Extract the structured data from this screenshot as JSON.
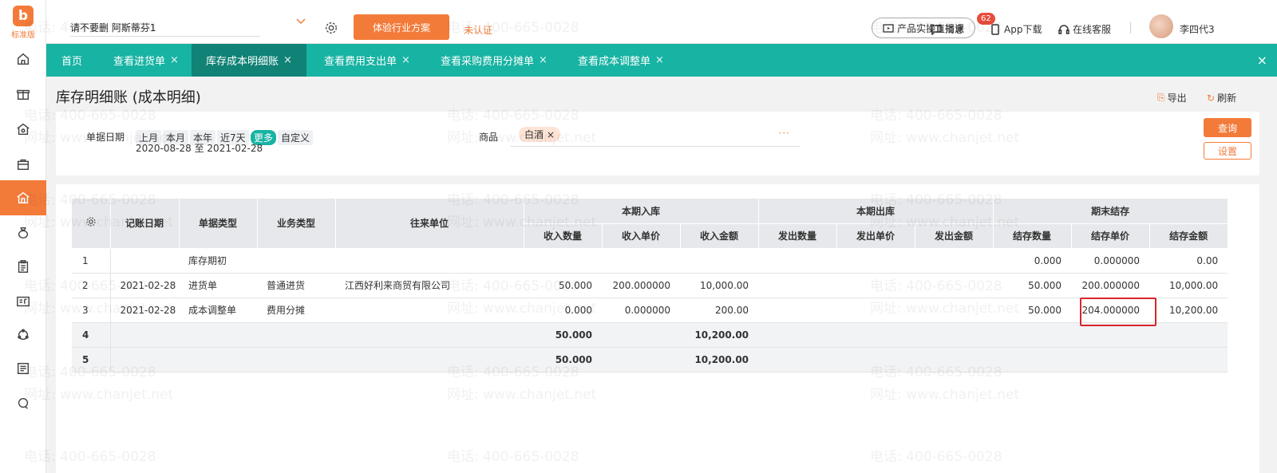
{
  "app": {
    "logo_letter": "b",
    "logo_text": "标准版"
  },
  "topbar": {
    "account_name": "请不要删 阿斯蒂芬1",
    "trial_button": "体验行业方案",
    "unverified": "未认证",
    "live_button": "产品实操直播课",
    "messages": "消息",
    "message_count": "62",
    "app_download": "App下载",
    "online_service": "在线客服",
    "user_name": "李四代3"
  },
  "tabs": [
    {
      "label": "首页",
      "closable": false
    },
    {
      "label": "查看进货单",
      "closable": true
    },
    {
      "label": "库存成本明细账",
      "closable": true,
      "active": true
    },
    {
      "label": "查看费用支出单",
      "closable": true
    },
    {
      "label": "查看采购费用分摊单",
      "closable": true
    },
    {
      "label": "查看成本调整单",
      "closable": true
    }
  ],
  "tab_close_all": "×",
  "page": {
    "title": "库存明细账 (成本明细)",
    "export": "导出",
    "refresh": "刷新"
  },
  "filter": {
    "date_label": "单据日期",
    "chips": [
      "上月",
      "本月",
      "本年",
      "近7天",
      "更多",
      "自定义"
    ],
    "active_chip": "更多",
    "date_from": "2020-08-28",
    "date_to_word": "至",
    "date_to": "2021-02-28",
    "goods_label": "商品",
    "goods_tag": "白酒",
    "goods_more": "···",
    "query_button": "查询",
    "settings_button": "设置"
  },
  "table": {
    "headers": {
      "post_date": "记账日期",
      "doc_type": "单据类型",
      "biz_type": "业务类型",
      "partner": "往来单位",
      "group_in": "本期入库",
      "group_out": "本期出库",
      "group_end": "期末结存",
      "in_qty": "收入数量",
      "in_price": "收入单价",
      "in_amount": "收入金额",
      "out_qty": "发出数量",
      "out_price": "发出单价",
      "out_amount": "发出金额",
      "end_qty": "结存数量",
      "end_price": "结存单价",
      "end_amount": "结存金额"
    },
    "rows": [
      {
        "no": "1",
        "date": "",
        "doc": "库存期初",
        "biz": "",
        "partner": "",
        "in_qty": "",
        "in_price": "",
        "in_amount": "",
        "out_qty": "",
        "out_price": "",
        "out_amount": "",
        "end_qty": "0.000",
        "end_price": "0.000000",
        "end_amount": "0.00"
      },
      {
        "no": "2",
        "date": "2021-02-28",
        "doc": "进货单",
        "biz": "普通进货",
        "partner": "江西好利来商贸有限公司",
        "in_qty": "50.000",
        "in_price": "200.000000",
        "in_amount": "10,000.00",
        "out_qty": "",
        "out_price": "",
        "out_amount": "",
        "end_qty": "50.000",
        "end_price": "200.000000",
        "end_amount": "10,000.00"
      },
      {
        "no": "3",
        "date": "2021-02-28",
        "doc": "成本调整单",
        "biz": "费用分摊",
        "partner": "",
        "in_qty": "0.000",
        "in_price": "0.000000",
        "in_amount": "200.00",
        "out_qty": "",
        "out_price": "",
        "out_amount": "",
        "end_qty": "50.000",
        "end_price": "204.000000",
        "end_amount": "10,200.00"
      }
    ],
    "totals": [
      {
        "no": "4",
        "in_qty": "50.000",
        "in_amount": "10,200.00"
      },
      {
        "no": "5",
        "in_qty": "50.000",
        "in_amount": "10,200.00"
      }
    ]
  },
  "watermark": {
    "phone": "电话: 400-665-0028",
    "site": "网址: www.chanjet.net"
  },
  "colors": {
    "brand_orange": "#f37b3a",
    "tab_teal": "#17b3a3",
    "tab_active": "#108276",
    "highlight_red": "#d9262c"
  }
}
